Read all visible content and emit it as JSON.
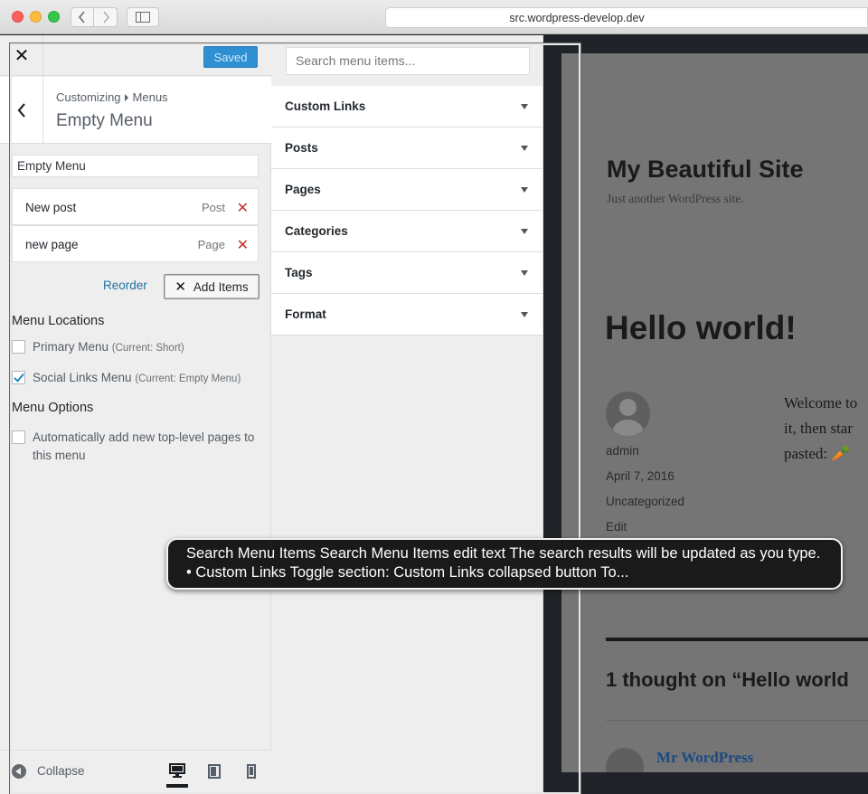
{
  "browser": {
    "url": "src.wordpress-develop.dev"
  },
  "customizer": {
    "saved_label": "Saved",
    "breadcrumb_parent": "Customizing",
    "breadcrumb_current": "Menus",
    "section_title": "Empty Menu",
    "menu_name_value": "Empty Menu",
    "menu_items": [
      {
        "title": "New post",
        "type": "Post"
      },
      {
        "title": "new page",
        "type": "Page"
      }
    ],
    "reorder_label": "Reorder",
    "add_items_label": "Add Items",
    "locations_heading": "Menu Locations",
    "locations": [
      {
        "label": "Primary Menu",
        "current": "(Current: Short)",
        "checked": false
      },
      {
        "label": "Social Links Menu",
        "current": "(Current: Empty Menu)",
        "checked": true
      }
    ],
    "options_heading": "Menu Options",
    "auto_add_label": "Automatically add new top-level pages to this menu",
    "collapse_label": "Collapse"
  },
  "available_items": {
    "search_placeholder": "Search menu items...",
    "sections": [
      "Custom Links",
      "Posts",
      "Pages",
      "Categories",
      "Tags",
      "Format"
    ]
  },
  "preview": {
    "site_title": "My Beautiful Site",
    "site_description": "Just another WordPress site.",
    "post_title": "Hello world!",
    "author": "admin",
    "date": "April 7, 2016",
    "category": "Uncategorized",
    "edit_label": "Edit",
    "body_lines": [
      "Welcome to",
      "it, then star",
      "pasted: "
    ],
    "comments_title": "1 thought on “Hello world",
    "commenter": "Mr WordPress"
  },
  "voiceover": {
    "caption": "Search Menu Items Search Menu Items edit text The search results will be updated as you type.  •  Custom Links  Toggle section: Custom Links collapsed button To..."
  }
}
